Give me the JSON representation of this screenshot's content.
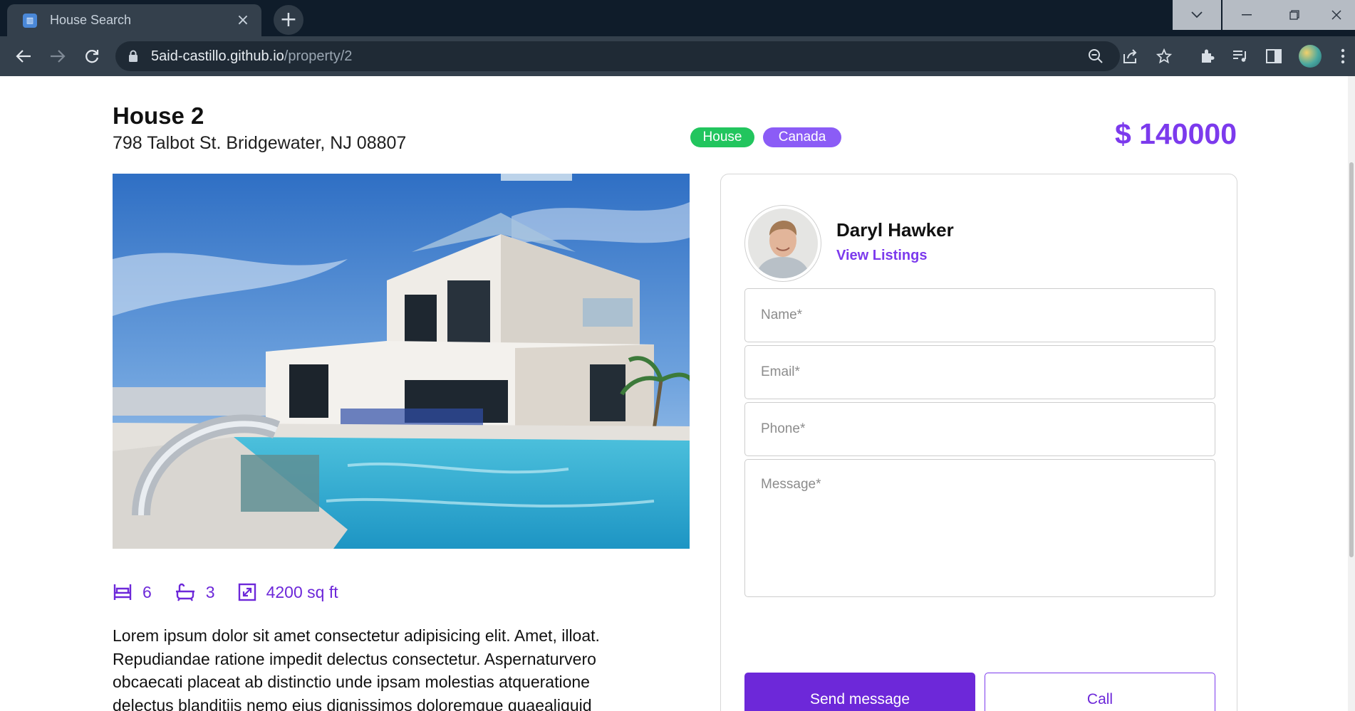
{
  "browser": {
    "tab_title": "House Search",
    "url_domain": "5aid-castillo.github.io",
    "url_path": "/property/2"
  },
  "property": {
    "title": "House 2",
    "address": "798 Talbot St. Bridgewater, NJ 08807",
    "tags": [
      "House",
      "Canada"
    ],
    "price": "$ 140000",
    "bedrooms": "6",
    "bathrooms": "3",
    "area": "4200 sq ft",
    "description": "Lorem ipsum dolor sit amet consectetur adipisicing elit. Amet, illoat. Repudiandae ratione impedit delectus consectetur. Aspernaturvero obcaecati placeat ab distinctio unde ipsam molestias atqueratione delectus blanditiis nemo eius dignissimos doloremque quaealiquid"
  },
  "agent": {
    "name": "Daryl Hawker",
    "view_listings": "View Listings"
  },
  "form": {
    "name_placeholder": "Name*",
    "email_placeholder": "Email*",
    "phone_placeholder": "Phone*",
    "message_placeholder": "Message*",
    "send_label": "Send message",
    "call_label": "Call"
  },
  "colors": {
    "accent": "#7c3aed",
    "tag_house": "#22c55e",
    "tag_country": "#8b5cf6"
  }
}
